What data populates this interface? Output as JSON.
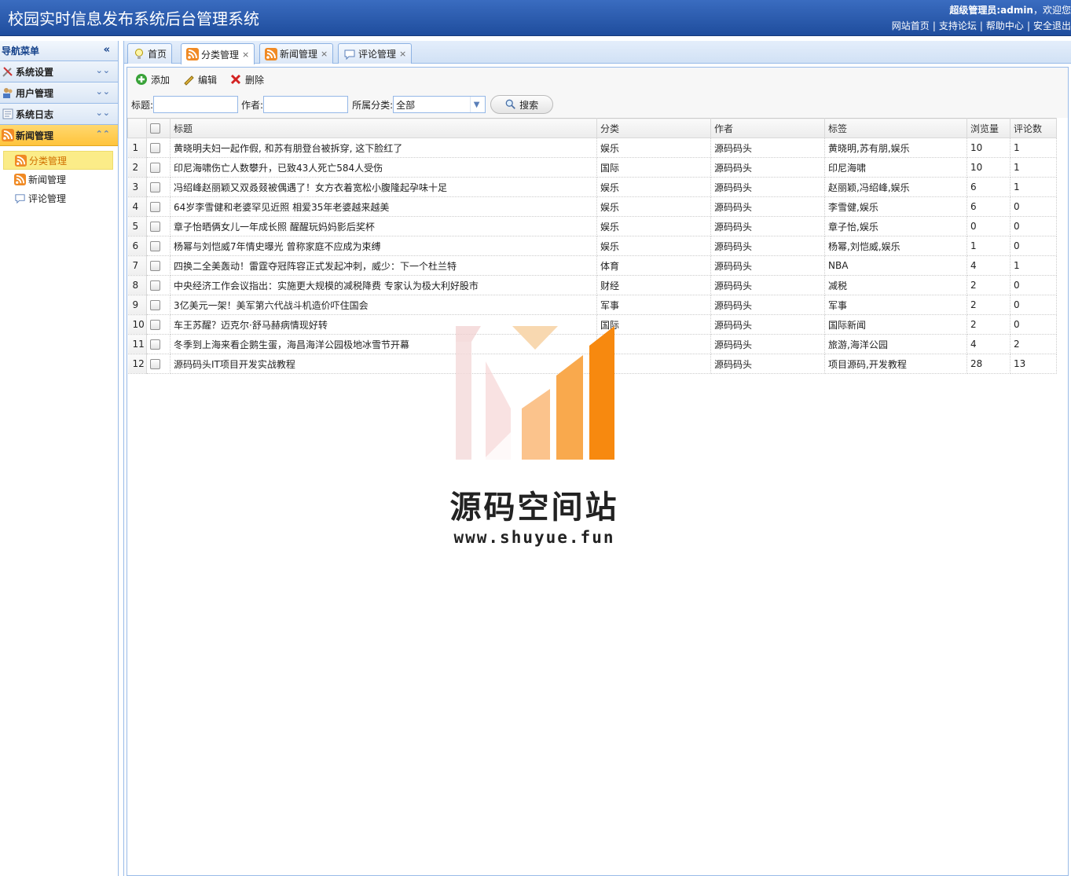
{
  "header": {
    "title": "校园实时信息发布系统后台管理系统",
    "welcome_prefix": "超级管理员:admin",
    "welcome_suffix": "，欢迎您",
    "links": [
      "网站首页",
      "支持论坛",
      "帮助中心",
      "安全退出"
    ]
  },
  "sidebar": {
    "title": "导航菜单",
    "sections": [
      {
        "label": "系统设置",
        "icon": "tools-icon"
      },
      {
        "label": "用户管理",
        "icon": "users-icon"
      },
      {
        "label": "系统日志",
        "icon": "log-icon"
      },
      {
        "label": "新闻管理",
        "icon": "rss-icon"
      }
    ],
    "items": [
      {
        "label": "分类管理",
        "icon": "rss-icon"
      },
      {
        "label": "新闻管理",
        "icon": "rss-icon"
      },
      {
        "label": "评论管理",
        "icon": "comment-icon"
      }
    ]
  },
  "tabs": [
    {
      "label": "首页",
      "icon": "bulb-icon"
    },
    {
      "label": "分类管理",
      "icon": "rss-icon"
    },
    {
      "label": "新闻管理",
      "icon": "rss-icon"
    },
    {
      "label": "评论管理",
      "icon": "comment-icon"
    }
  ],
  "toolbar": {
    "add": "添加",
    "edit": "编辑",
    "delete": "删除"
  },
  "search": {
    "title_label": "标题:",
    "author_label": "作者:",
    "category_label": "所属分类:",
    "category_value": "全部",
    "button": "搜索"
  },
  "grid": {
    "columns": [
      "标题",
      "分类",
      "作者",
      "标签",
      "浏览量",
      "评论数"
    ],
    "rows": [
      {
        "n": "1",
        "title": "黄晓明夫妇一起作假, 和苏有朋登台被拆穿, 这下脸红了",
        "category": "娱乐",
        "author": "源码码头",
        "tags": "黄晓明,苏有朋,娱乐",
        "views": "10",
        "comments": "1"
      },
      {
        "n": "2",
        "title": "印尼海啸伤亡人数攀升，已致43人死亡584人受伤",
        "category": "国际",
        "author": "源码码头",
        "tags": "印尼海啸",
        "views": "10",
        "comments": "1"
      },
      {
        "n": "3",
        "title": "冯绍峰赵丽颖又双叒叕被偶遇了！女方衣着宽松小腹隆起孕味十足",
        "category": "娱乐",
        "author": "源码码头",
        "tags": "赵丽颖,冯绍峰,娱乐",
        "views": "6",
        "comments": "1"
      },
      {
        "n": "4",
        "title": "64岁李雪健和老婆罕见近照 相爱35年老婆越来越美",
        "category": "娱乐",
        "author": "源码码头",
        "tags": "李雪健,娱乐",
        "views": "6",
        "comments": "0"
      },
      {
        "n": "5",
        "title": "章子怡晒俩女儿一年成长照 醒醒玩妈妈影后奖杯",
        "category": "娱乐",
        "author": "源码码头",
        "tags": "章子怡,娱乐",
        "views": "0",
        "comments": "0"
      },
      {
        "n": "6",
        "title": "杨幂与刘恺威7年情史曝光 曾称家庭不应成为束缚",
        "category": "娱乐",
        "author": "源码码头",
        "tags": "杨幂,刘恺威,娱乐",
        "views": "1",
        "comments": "0"
      },
      {
        "n": "7",
        "title": "四换二全美轰动！雷霆夺冠阵容正式发起冲刺，威少：下一个杜兰特",
        "category": "体育",
        "author": "源码码头",
        "tags": "NBA",
        "views": "4",
        "comments": "1"
      },
      {
        "n": "8",
        "title": "中央经济工作会议指出：实施更大规模的减税降费 专家认为极大利好股市",
        "category": "财经",
        "author": "源码码头",
        "tags": "减税",
        "views": "2",
        "comments": "0"
      },
      {
        "n": "9",
        "title": "3亿美元一架！美军第六代战斗机造价吓住国会",
        "category": "军事",
        "author": "源码码头",
        "tags": "军事",
        "views": "2",
        "comments": "0"
      },
      {
        "n": "10",
        "title": "车王苏醒？迈克尔·舒马赫病情现好转",
        "category": "国际",
        "author": "源码码头",
        "tags": "国际新闻",
        "views": "2",
        "comments": "0"
      },
      {
        "n": "11",
        "title": "冬季到上海来看企鹅生蛋，海昌海洋公园极地冰雪节开幕",
        "category": "",
        "author": "源码码头",
        "tags": "旅游,海洋公园",
        "views": "4",
        "comments": "2"
      },
      {
        "n": "12",
        "title": "源码码头IT项目开发实战教程",
        "category": "",
        "author": "源码码头",
        "tags": "项目源码,开发教程",
        "views": "28",
        "comments": "13"
      }
    ]
  },
  "watermark": {
    "brand": "源码空间站",
    "url": "www.shuyue.fun"
  },
  "colors": {
    "header": "#2a5aae",
    "accent": "#ffc43c",
    "watermark_orange": "#f7890f"
  }
}
